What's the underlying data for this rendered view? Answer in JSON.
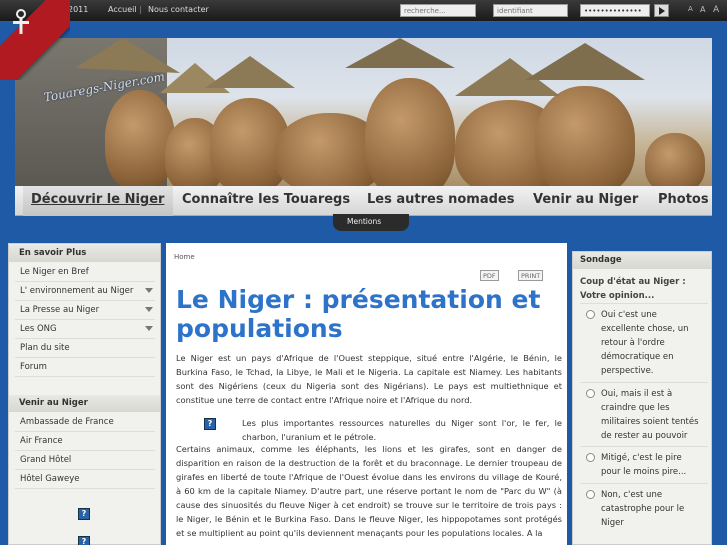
{
  "topbar": {
    "year_text": "2011",
    "links": [
      "Accueil",
      "Nous contacter"
    ],
    "separator": "|",
    "search_placeholder": "recherche...",
    "login_placeholder": "identifiant",
    "password_value": "••••••••••••••",
    "font_sizes": [
      "A",
      "A",
      "A"
    ]
  },
  "header": {
    "brand_text": "Touaregs-Niger.com"
  },
  "nav": {
    "items": [
      "Découvrir le Niger",
      "Connaître les Touaregs",
      "Les autres nomades",
      "Venir au Niger",
      "Photos"
    ],
    "active_index": 0,
    "subnav_label": "Mentions"
  },
  "sidebar": {
    "section1": {
      "title": "En savoir Plus",
      "items": [
        {
          "label": "Le Niger en Bref",
          "has_arrow": false
        },
        {
          "label": "L' environnement au Niger",
          "has_arrow": true
        },
        {
          "label": "La Presse au Niger",
          "has_arrow": true
        },
        {
          "label": "Les ONG",
          "has_arrow": true
        },
        {
          "label": "Plan du site",
          "has_arrow": false
        },
        {
          "label": "Forum",
          "has_arrow": false
        }
      ]
    },
    "section2": {
      "title": "Venir au Niger",
      "items": [
        {
          "label": "Ambassade de France"
        },
        {
          "label": "Air France"
        },
        {
          "label": "Grand Hôtel"
        },
        {
          "label": "Hôtel Gaweye"
        }
      ]
    }
  },
  "main": {
    "breadcrumb": "Home",
    "pdf_label": "PDF",
    "print_label": "PRINT",
    "title": "Le Niger : présentation et populations",
    "paragraph1": "Le Niger est un pays d'Afrique de l'Ouest steppique, situé entre l'Algérie, le Bénin, le Burkina Faso, le Tchad, la Libye, le Mali et le Nigeria. La capitale est Niamey. Les habitants sont des Nigériens (ceux du Nigeria sont des Nigérians). Le pays est multiethnique et constitue une terre de contact entre l'Afrique noire et l'Afrique du nord.",
    "paragraph2": "Les plus importantes ressources naturelles du Niger sont l'or, le fer, le charbon, l'uranium et le pétrole.",
    "paragraph3": "Certains animaux, comme les éléphants, les lions et les girafes, sont en danger de disparition en raison de la destruction de la forêt et du braconnage. Le dernier troupeau de girafes en liberté de toute l'Afrique de l'Ouest évolue dans les environs du village de Kouré, à 60 km de la capitale Niamey. D'autre part, une réserve portant le nom de \"Parc du W\" (à cause des sinuosités du fleuve Niger à cet endroit) se trouve sur le territoire de trois pays : le Niger, le Bénin et le Burkina Faso. Dans le fleuve Niger, les hippopotames sont protégés et se multiplient au point qu'ils deviennent menaçants pour les populations locales. A la"
  },
  "poll": {
    "title": "Sondage",
    "question": "Coup d'état au Niger : Votre opinion...",
    "options": [
      "Oui c'est une excellente chose, un retour à l'ordre démocratique en perspective.",
      "Oui, mais il est à craindre que les militaires soient tentés de rester au pouvoir",
      "Mitigé, c'est le pire pour le moins pire...",
      "Non, c'est une catastrophe pour le Niger"
    ]
  },
  "colors": {
    "background": "#1e5aa6",
    "title_blue": "#2d73c9",
    "ribbon_red": "#b01a20"
  }
}
